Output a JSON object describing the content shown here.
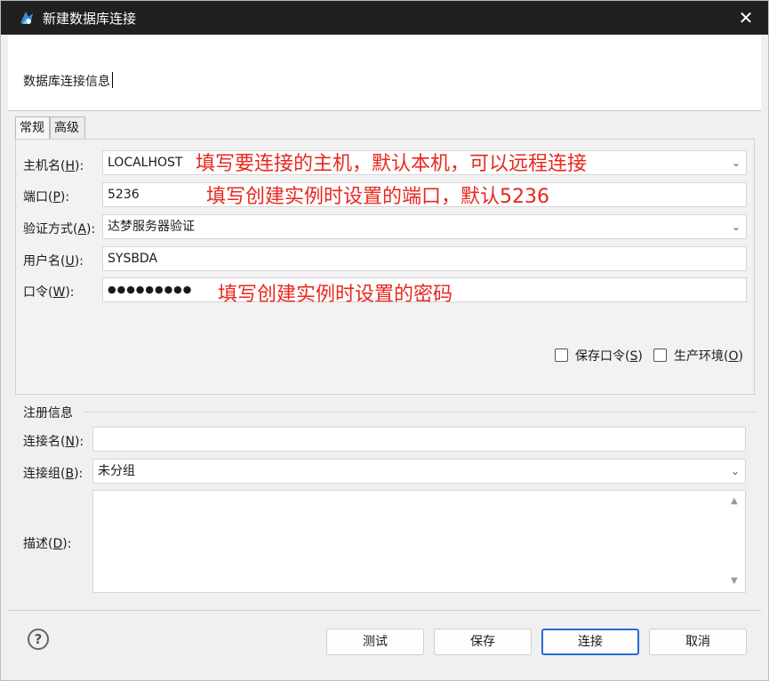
{
  "window": {
    "title": "新建数据库连接",
    "close_glyph": "✕",
    "app_icon": "dm-tool-icon"
  },
  "banner": {
    "text": "数据库连接信息"
  },
  "tabs": [
    {
      "label": "常规",
      "active": true
    },
    {
      "label": "高级",
      "active": false
    }
  ],
  "form": {
    "host": {
      "label_prefix": "主机名(",
      "mnemonic": "H",
      "label_suffix": "):",
      "value": "LOCALHOST"
    },
    "port": {
      "label_prefix": "端口(",
      "mnemonic": "P",
      "label_suffix": "):",
      "value": "5236"
    },
    "auth": {
      "label_prefix": "验证方式(",
      "mnemonic": "A",
      "label_suffix": "):",
      "value": "达梦服务器验证"
    },
    "user": {
      "label_prefix": "用户名(",
      "mnemonic": "U",
      "label_suffix": "):",
      "value": "SYSBDA"
    },
    "password": {
      "label_prefix": "口令(",
      "mnemonic": "W",
      "label_suffix": "):",
      "value": "●●●●●●●●●"
    },
    "save_password": {
      "label_prefix": "保存口令(",
      "mnemonic": "S",
      "label_suffix": ")",
      "checked": false
    },
    "production": {
      "label_prefix": "生产环境(",
      "mnemonic": "O",
      "label_suffix": ")",
      "checked": false
    }
  },
  "annotations": {
    "host": "填写要连接的主机，默认本机，可以远程连接",
    "port": "填写创建实例时设置的端口，默认5236",
    "password": "填写创建实例时设置的密码"
  },
  "registration": {
    "title": "注册信息",
    "conn_name": {
      "label_prefix": "连接名(",
      "mnemonic": "N",
      "label_suffix": "):",
      "value": ""
    },
    "conn_group": {
      "label_prefix": "连接组(",
      "mnemonic": "B",
      "label_suffix": "):",
      "value": "未分组"
    },
    "description": {
      "label_prefix": "描述(",
      "mnemonic": "D",
      "label_suffix": "):",
      "value": ""
    }
  },
  "buttons": {
    "help": "?",
    "test": "测试",
    "save": "保存",
    "connect": "连接",
    "cancel": "取消"
  },
  "colors": {
    "titlebar": "#202020",
    "annotation": "#e8281e",
    "default_button_border": "#2a6bd3"
  }
}
